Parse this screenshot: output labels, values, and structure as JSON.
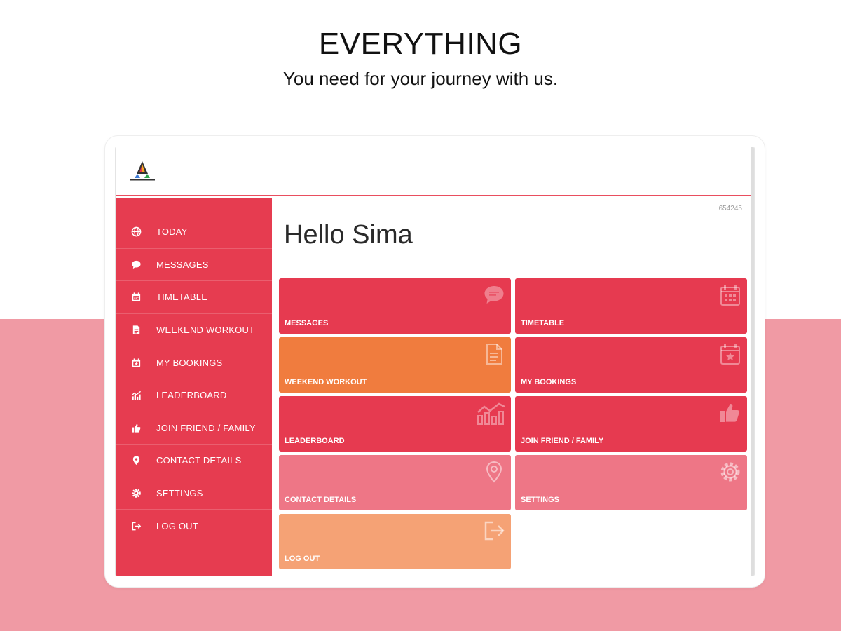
{
  "header": {
    "headline": "EVERYTHING",
    "subline": "You need for your journey with us."
  },
  "colors": {
    "primary_red": "#e63a50",
    "orange": "#f07c3e",
    "pink": "#ee7686",
    "peach": "#f5a275",
    "background_band": "#f09aa4"
  },
  "app": {
    "logo": "app-logo",
    "user_code": "654245",
    "greeting": "Hello Sima"
  },
  "sidebar": {
    "items": [
      {
        "label": "TODAY",
        "icon": "globe-icon"
      },
      {
        "label": "MESSAGES",
        "icon": "chat-icon"
      },
      {
        "label": "TIMETABLE",
        "icon": "calendar-icon"
      },
      {
        "label": "WEEKEND WORKOUT",
        "icon": "document-icon"
      },
      {
        "label": "MY BOOKINGS",
        "icon": "calendar-star-icon"
      },
      {
        "label": "LEADERBOARD",
        "icon": "chart-icon"
      },
      {
        "label": "JOIN FRIEND / FAMILY",
        "icon": "thumbs-up-icon"
      },
      {
        "label": "CONTACT DETAILS",
        "icon": "location-pin-icon"
      },
      {
        "label": "SETTINGS",
        "icon": "gear-icon"
      },
      {
        "label": "LOG OUT",
        "icon": "logout-icon"
      }
    ]
  },
  "tiles": [
    {
      "label": "MESSAGES",
      "icon": "chat-icon",
      "color": "#e63a50"
    },
    {
      "label": "TIMETABLE",
      "icon": "calendar-icon",
      "color": "#e63a50"
    },
    {
      "label": "WEEKEND WORKOUT",
      "icon": "document-icon",
      "color": "#f07c3e"
    },
    {
      "label": "MY BOOKINGS",
      "icon": "calendar-star-icon",
      "color": "#e63a50"
    },
    {
      "label": "LEADERBOARD",
      "icon": "chart-icon",
      "color": "#e63a50"
    },
    {
      "label": "JOIN FRIEND / FAMILY",
      "icon": "thumbs-up-icon",
      "color": "#e63a50"
    },
    {
      "label": "CONTACT DETAILS",
      "icon": "location-pin-icon",
      "color": "#ee7686"
    },
    {
      "label": "SETTINGS",
      "icon": "gear-icon",
      "color": "#ee7686"
    },
    {
      "label": "LOG OUT",
      "icon": "logout-icon",
      "color": "#f5a275"
    }
  ]
}
